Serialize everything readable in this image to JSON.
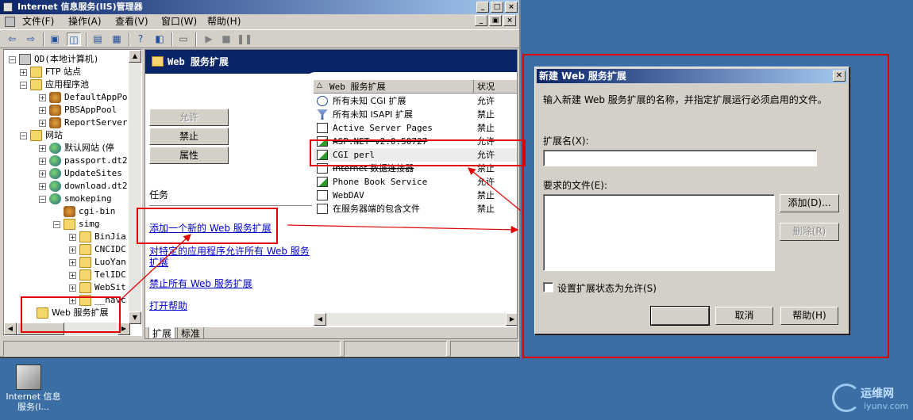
{
  "window": {
    "title": "Internet 信息服务(IIS)管理器",
    "controls": [
      "_",
      "□",
      "×"
    ],
    "mdi_controls": [
      "_",
      "▣",
      "×"
    ]
  },
  "menu": [
    "文件(F)",
    "操作(A)",
    "查看(V)",
    "窗口(W)",
    "帮助(H)"
  ],
  "tree": {
    "items": [
      {
        "label": "QD(本地计算机)",
        "icon": "computer-icon",
        "expand": "−"
      },
      {
        "label": "FTP 站点",
        "icon": "ftp-folder-icon",
        "expand": "+"
      },
      {
        "label": "应用程序池",
        "icon": "folder-icon",
        "expand": "−"
      },
      {
        "label": "DefaultAppPo",
        "icon": "app-pool-icon",
        "expand": "+"
      },
      {
        "label": "PBSAppPool",
        "icon": "app-pool-icon",
        "expand": "+"
      },
      {
        "label": "ReportServer",
        "icon": "app-pool-icon",
        "expand": "+"
      },
      {
        "label": "网站",
        "icon": "folder-icon",
        "expand": "−"
      },
      {
        "label": "默认网站 (停",
        "icon": "globe-icon",
        "expand": "+"
      },
      {
        "label": "passport.dt2",
        "icon": "globe-icon",
        "expand": "+"
      },
      {
        "label": "UpdateSites",
        "icon": "globe-icon",
        "expand": "+"
      },
      {
        "label": "download.dt2",
        "icon": "globe-icon",
        "expand": "+"
      },
      {
        "label": "smokeping",
        "icon": "globe-icon",
        "expand": "−"
      },
      {
        "label": "cgi-bin",
        "icon": "gear-folder-icon",
        "expand": ""
      },
      {
        "label": "simg",
        "icon": "folder-icon",
        "expand": "−"
      },
      {
        "label": "BinJia",
        "icon": "folder-icon",
        "expand": "+"
      },
      {
        "label": "CNCIDC",
        "icon": "folder-icon",
        "expand": "+"
      },
      {
        "label": "LuoYan",
        "icon": "folder-icon",
        "expand": "+"
      },
      {
        "label": "TelIDC",
        "icon": "folder-icon",
        "expand": "+"
      },
      {
        "label": "WebSit",
        "icon": "folder-icon",
        "expand": "+"
      },
      {
        "label": "__navc",
        "icon": "folder-icon",
        "expand": "+"
      },
      {
        "label": "Web 服务扩展",
        "icon": "folder-icon",
        "expand": ""
      }
    ]
  },
  "content": {
    "header": "Web 服务扩展",
    "buttons": {
      "allow": "允许",
      "deny": "禁止",
      "properties": "属性"
    },
    "tasks_label": "任务",
    "tasks": [
      "添加一个新的 Web 服务扩展",
      "对特定的应用程序允许所有 Web 服务扩展",
      "禁止所有 Web 服务扩展",
      "打开帮助"
    ],
    "columns": {
      "name": "Web 服务扩展",
      "status": "状况"
    },
    "extensions": [
      {
        "name": "所有未知 CGI 扩展",
        "status": "允许",
        "icon": "info-icon"
      },
      {
        "name": "所有未知 ISAPI 扩展",
        "status": "禁止",
        "icon": "filter-icon"
      },
      {
        "name": "Active Server Pages",
        "status": "禁止",
        "icon": "document-icon"
      },
      {
        "name": "ASP.NET v2.0.50727",
        "status": "允许",
        "icon": "document-check-icon"
      },
      {
        "name": "CGI perl",
        "status": "允许",
        "icon": "document-check-icon"
      },
      {
        "name": "Internet 数据连接器",
        "status": "禁止",
        "icon": "document-icon"
      },
      {
        "name": "Phone Book Service",
        "status": "允许",
        "icon": "document-check-icon"
      },
      {
        "name": "WebDAV",
        "status": "禁止",
        "icon": "document-icon"
      },
      {
        "name": "在服务器端的包含文件",
        "status": "禁止",
        "icon": "document-icon"
      }
    ],
    "tabs": [
      "扩展",
      "标准"
    ]
  },
  "dialog": {
    "title": "新建 Web 服务扩展",
    "description": "输入新建 Web 服务扩展的名称，并指定扩展运行必须启用的文件。",
    "name_label": "扩展名(X):",
    "name_value": "",
    "files_label": "要求的文件(E):",
    "add_button": "添加(D)...",
    "remove_button": "删除(R)",
    "checkbox_label": "设置扩展状态为允许(S)",
    "ok_button": "",
    "cancel_button": "取消",
    "help_button": "帮助(H)"
  },
  "desktop": {
    "icon_label": "Internet 信息服务(I..."
  },
  "watermark": {
    "text": "运维网",
    "sub": "iyunv.com"
  },
  "annotation_color": "#e00000"
}
